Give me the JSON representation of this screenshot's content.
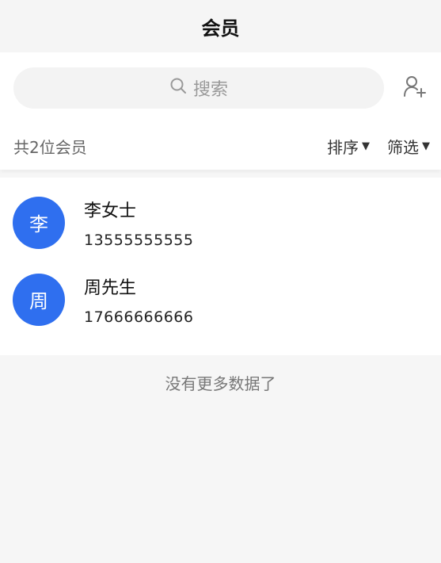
{
  "header": {
    "title": "会员"
  },
  "search": {
    "placeholder": "搜索",
    "icon": "search-icon"
  },
  "actions": {
    "add_member_icon": "add-user-icon"
  },
  "toolbar": {
    "count_text": "共2位会员",
    "sort_label": "排序",
    "filter_label": "筛选"
  },
  "members": [
    {
      "avatar_char": "李",
      "name": "李女士",
      "phone": "13555555555"
    },
    {
      "avatar_char": "周",
      "name": "周先生",
      "phone": "17666666666"
    }
  ],
  "footer": {
    "no_more_text": "没有更多数据了"
  },
  "colors": {
    "avatar_bg": "#2f6fef",
    "page_bg": "#f6f6f6"
  }
}
